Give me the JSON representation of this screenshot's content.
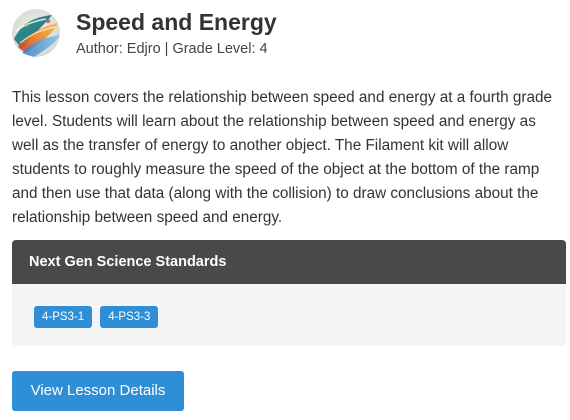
{
  "lesson": {
    "title": "Speed and Energy",
    "subtitle": "Author: Edjro | Grade Level: 4",
    "thumbnail_icon": "abstract-swirl-thumbnail-icon",
    "description": "This lesson covers the relationship between speed and energy at a fourth grade level. Students will learn about the relationship between speed and energy as well as the transfer of energy to another object. The Filament kit will allow students to roughly measure the speed of the object at the bottom of the ramp and then use that data (along with the collision) to draw conclusions about the relationship between speed and energy."
  },
  "standards": {
    "heading": "Next Gen Science Standards",
    "badges": [
      {
        "label": "4-PS3-1"
      },
      {
        "label": "4-PS3-3"
      }
    ]
  },
  "actions": {
    "view_details_label": "View Lesson Details"
  },
  "colors": {
    "accent": "#2e8fd6",
    "card_header_bg": "#494949",
    "card_body_bg": "#f5f5f5",
    "text": "#333333"
  }
}
